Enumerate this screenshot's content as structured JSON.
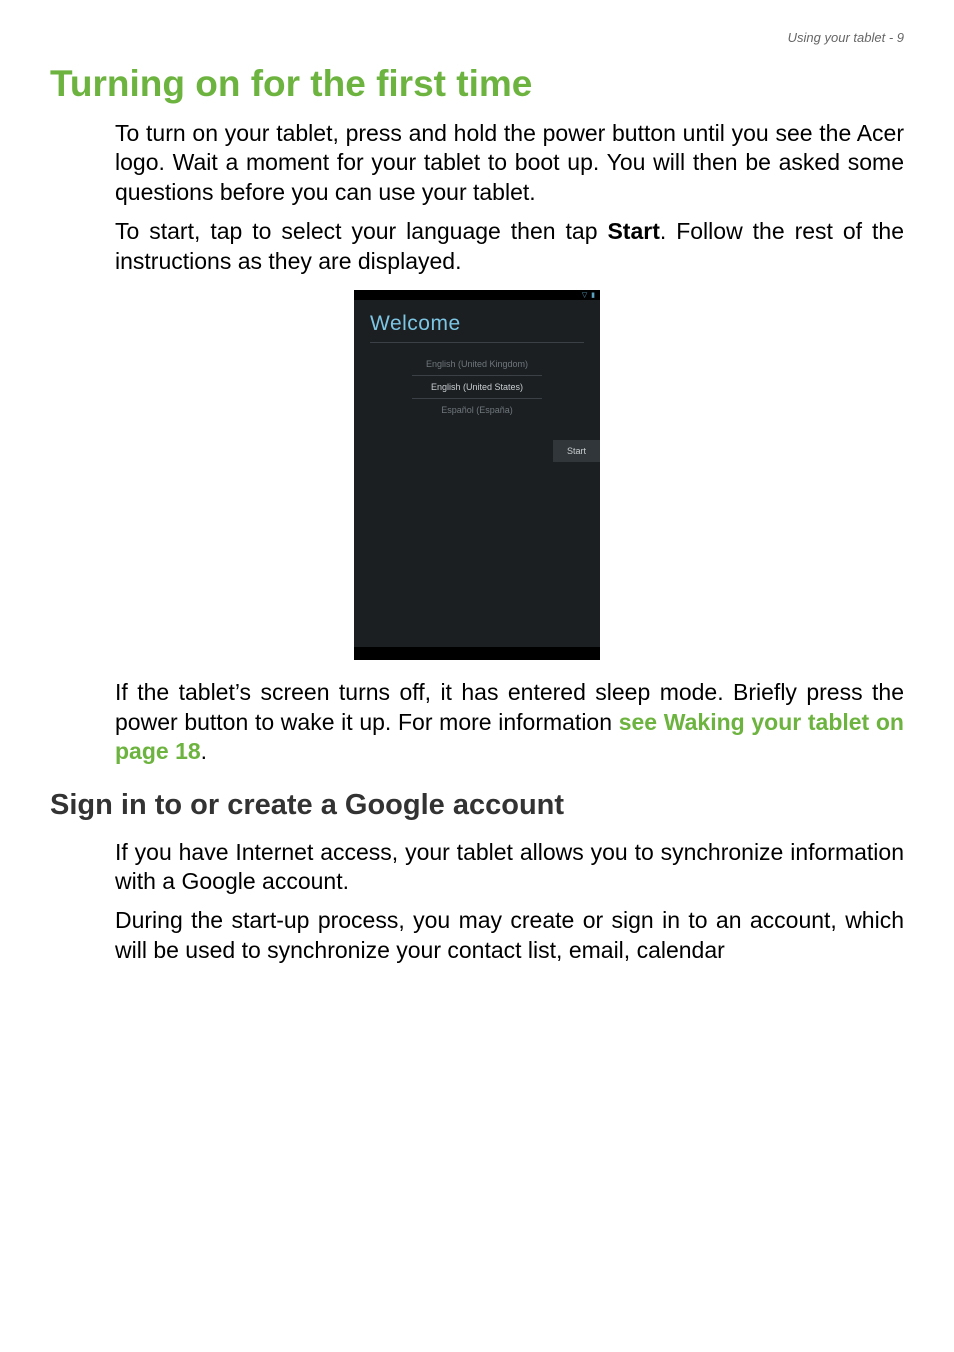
{
  "header": {
    "right": "Using your tablet - 9"
  },
  "h1": "Turning on for the first time",
  "para1_a": "To turn on your tablet, press and hold the power button until you see the Acer logo. Wait a moment for your tablet to boot up. You will then be asked some questions before you can use your tablet.",
  "para2_a": "To start, tap to select your language then tap ",
  "para2_bold": "Start",
  "para2_b": ". Follow the rest of the instructions as they are displayed.",
  "screenshot": {
    "welcome": "Welcome",
    "lang1": "English (United Kingdom)",
    "lang2": "English (United States)",
    "lang3": "Español (España)",
    "start": "Start",
    "status_icons": "▽ ▮"
  },
  "para3_a": "If the tablet’s screen turns off, it has entered sleep mode. Briefly press the power button to wake it up. For more information ",
  "para3_link": "see Waking your tablet on page 18",
  "para3_b": ".",
  "h2": "Sign in to or create a Google account",
  "para4": "If you have Internet access, your tablet allows you to synchronize information with a Google account.",
  "para5": "During the start-up process, you may create or sign in to an account, which will be used to synchronize your contact list, email, calendar"
}
